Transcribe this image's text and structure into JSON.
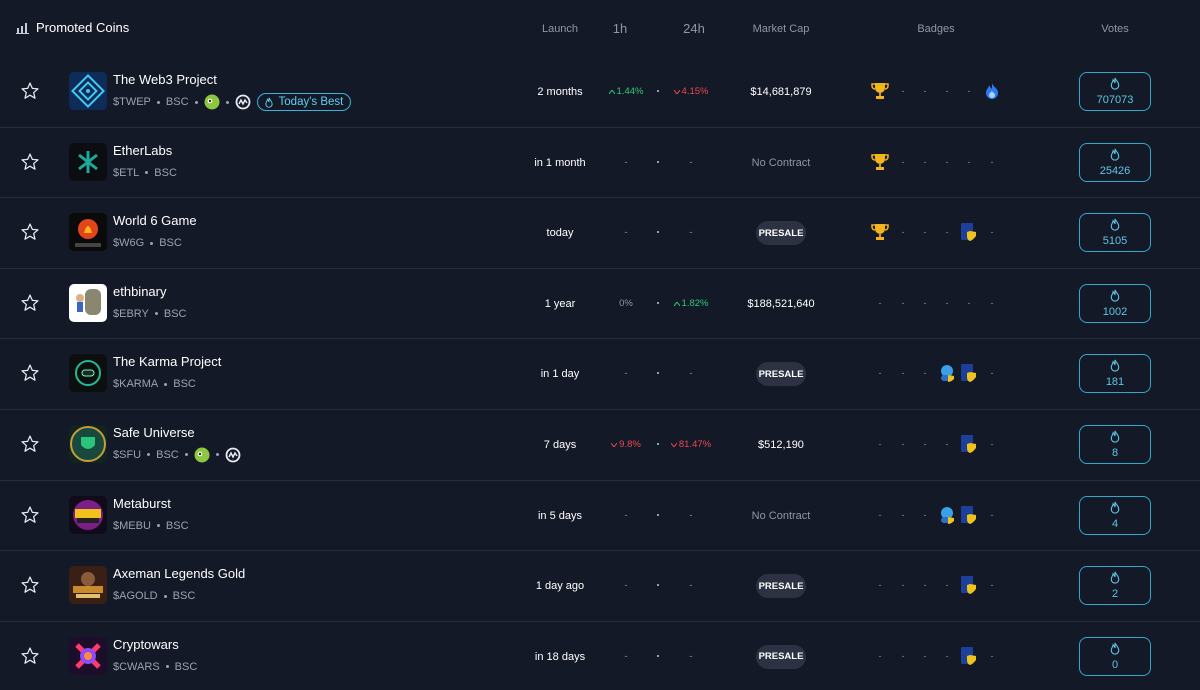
{
  "header": {
    "title": "Promoted Coins",
    "cols": {
      "launch": "Launch",
      "h1": "1h",
      "h24": "24h",
      "mcap": "Market Cap",
      "badges": "Badges",
      "votes": "Votes"
    }
  },
  "colors": {
    "bg": "#141927",
    "accent": "#31a9cc",
    "up": "#2ecb7a",
    "down": "#f0474f"
  },
  "rows": [
    {
      "name": "The Web3 Project",
      "symbol": "$TWEP",
      "chain": "BSC",
      "extras": [
        "coingecko-icon",
        "coinmarketcap-icon"
      ],
      "best": "Today's Best",
      "launch": "2 months",
      "h1": "1.44%",
      "h1dir": "up",
      "h24": "4.15%",
      "h24dir": "down",
      "mcap": "$14,681,879",
      "mcap_kind": "value",
      "badges": [
        "trophy",
        "-",
        "-",
        "-",
        "-",
        "flame"
      ],
      "votes": "707073",
      "logo": "web3"
    },
    {
      "name": "EtherLabs",
      "symbol": "$ETL",
      "chain": "BSC",
      "extras": [],
      "launch": "in 1 month",
      "h1": "-",
      "h1dir": "neu",
      "h24": "-",
      "h24dir": "neu",
      "mcap": "No Contract",
      "mcap_kind": "muted",
      "badges": [
        "trophy",
        "-",
        "-",
        "-",
        "-",
        "-"
      ],
      "votes": "25426",
      "logo": "etherlabs"
    },
    {
      "name": "World 6 Game",
      "symbol": "$W6G",
      "chain": "BSC",
      "extras": [],
      "launch": "today",
      "h1": "-",
      "h1dir": "neu",
      "h24": "-",
      "h24dir": "neu",
      "mcap": "PRESALE",
      "mcap_kind": "presale",
      "badges": [
        "trophy",
        "-",
        "-",
        "-",
        "shield",
        "-"
      ],
      "votes": "5105",
      "logo": "world6"
    },
    {
      "name": "ethbinary",
      "symbol": "$EBRY",
      "chain": "BSC",
      "extras": [],
      "launch": "1 year",
      "h1": "0%",
      "h1dir": "neu",
      "h24": "1.82%",
      "h24dir": "up",
      "mcap": "$188,521,640",
      "mcap_kind": "value",
      "badges": [
        "-",
        "-",
        "-",
        "-",
        "-",
        "-"
      ],
      "votes": "1002",
      "logo": "ethbinary"
    },
    {
      "name": "The Karma Project",
      "symbol": "$KARMA",
      "chain": "BSC",
      "extras": [],
      "launch": "in 1 day",
      "h1": "-",
      "h1dir": "neu",
      "h24": "-",
      "h24dir": "neu",
      "mcap": "PRESALE",
      "mcap_kind": "presale",
      "badges": [
        "-",
        "-",
        "-",
        "doxx",
        "shield",
        "-"
      ],
      "votes": "181",
      "logo": "karma"
    },
    {
      "name": "Safe Universe",
      "symbol": "$SFU",
      "chain": "BSC",
      "extras": [
        "coingecko-icon",
        "coinmarketcap-icon"
      ],
      "launch": "7 days",
      "h1": "9.8%",
      "h1dir": "down",
      "h24": "81.47%",
      "h24dir": "down",
      "mcap": "$512,190",
      "mcap_kind": "value",
      "badges": [
        "-",
        "-",
        "-",
        "-",
        "shield",
        "-"
      ],
      "votes": "8",
      "logo": "safeuniverse"
    },
    {
      "name": "Metaburst",
      "symbol": "$MEBU",
      "chain": "BSC",
      "extras": [],
      "launch": "in 5 days",
      "h1": "-",
      "h1dir": "neu",
      "h24": "-",
      "h24dir": "neu",
      "mcap": "No Contract",
      "mcap_kind": "muted",
      "badges": [
        "-",
        "-",
        "-",
        "doxx",
        "shield",
        "-"
      ],
      "votes": "4",
      "logo": "metaburst"
    },
    {
      "name": "Axeman Legends Gold",
      "symbol": "$AGOLD",
      "chain": "BSC",
      "extras": [],
      "launch": "1 day ago",
      "h1": "-",
      "h1dir": "neu",
      "h24": "-",
      "h24dir": "neu",
      "mcap": "PRESALE",
      "mcap_kind": "presale",
      "badges": [
        "-",
        "-",
        "-",
        "-",
        "shield",
        "-"
      ],
      "votes": "2",
      "logo": "axeman"
    },
    {
      "name": "Cryptowars",
      "symbol": "$CWARS",
      "chain": "BSC",
      "extras": [],
      "launch": "in 18 days",
      "h1": "-",
      "h1dir": "neu",
      "h24": "-",
      "h24dir": "neu",
      "mcap": "PRESALE",
      "mcap_kind": "presale",
      "badges": [
        "-",
        "-",
        "-",
        "-",
        "shield",
        "-"
      ],
      "votes": "0",
      "logo": "cryptowars"
    }
  ]
}
